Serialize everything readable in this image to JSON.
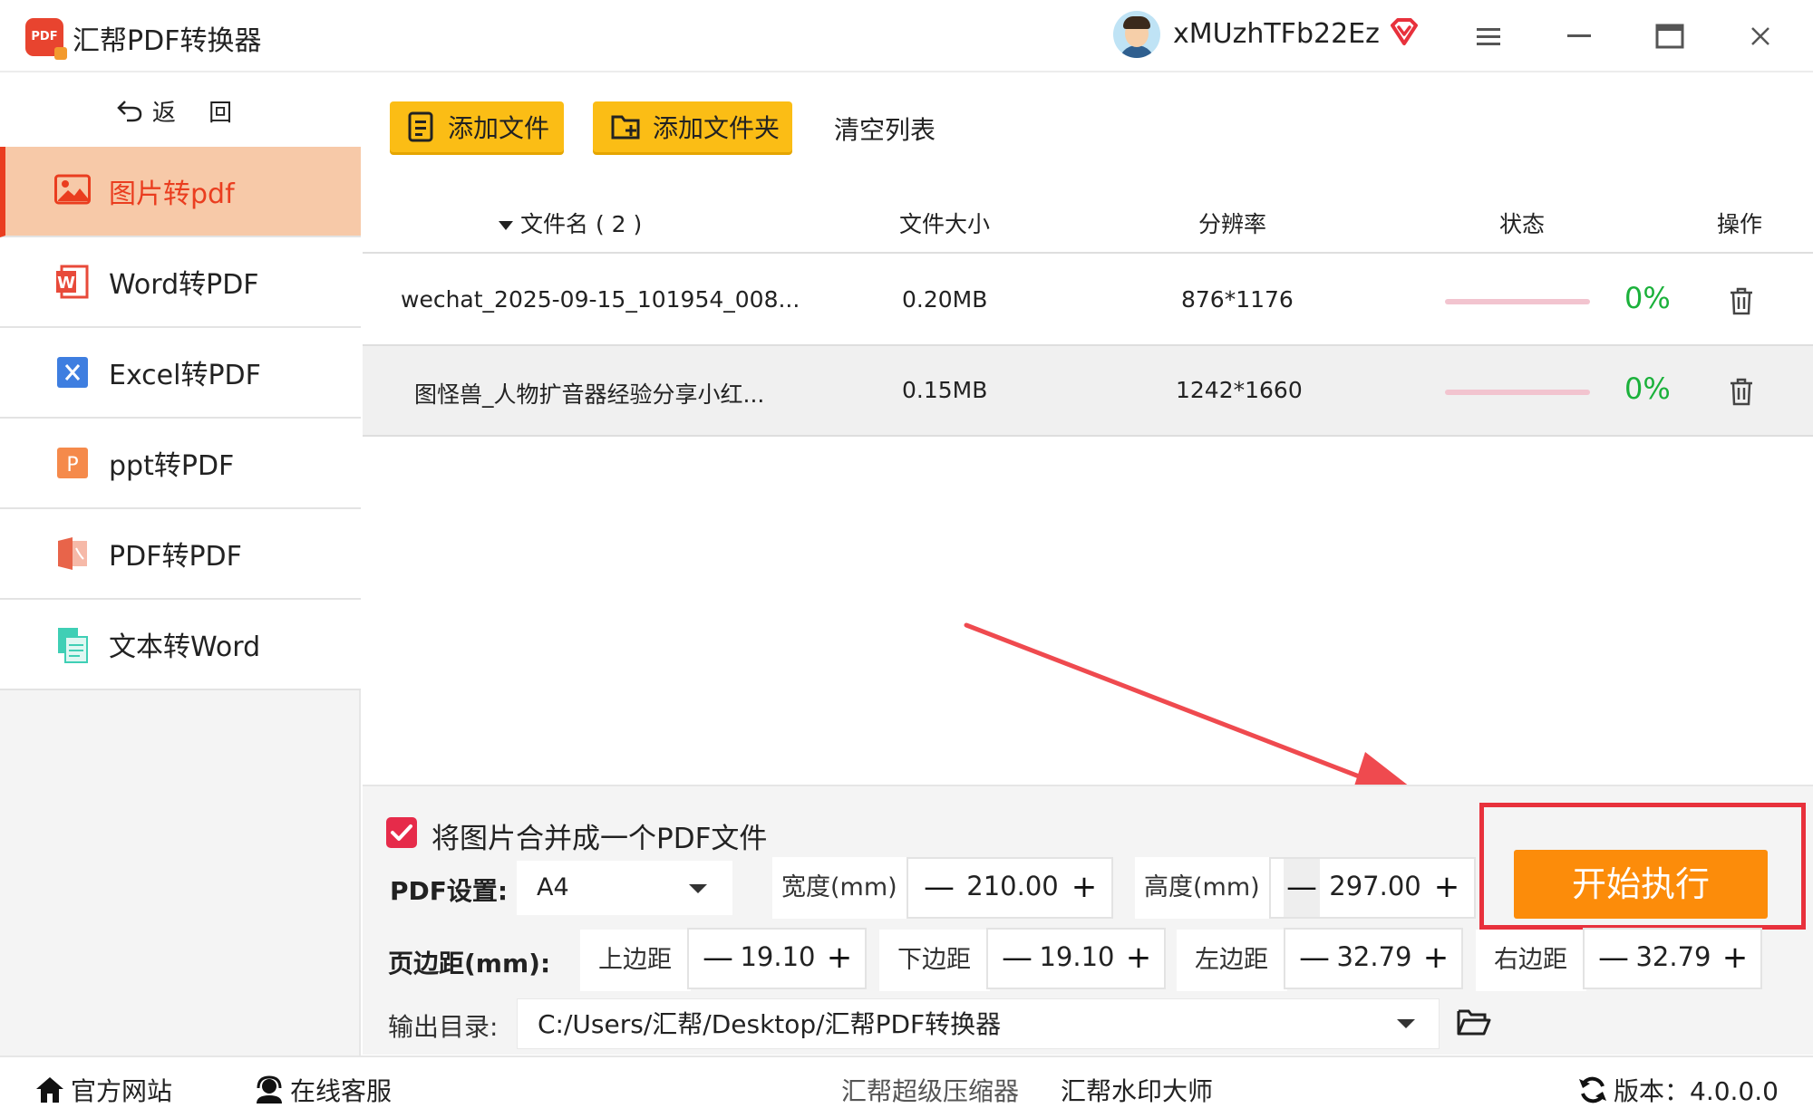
{
  "app": {
    "title": "汇帮PDF转换器",
    "logo_text": "PDF",
    "username": "xMUzhTFb22Ez"
  },
  "sidebar": {
    "back_label": "返 回",
    "items": [
      {
        "label": "图片转pdf",
        "icon": "image-icon",
        "active": true
      },
      {
        "label": "Word转PDF",
        "icon": "word-icon",
        "active": false
      },
      {
        "label": "Excel转PDF",
        "icon": "excel-icon",
        "active": false
      },
      {
        "label": "ppt转PDF",
        "icon": "ppt-icon",
        "active": false
      },
      {
        "label": "PDF转PDF",
        "icon": "pdf-icon",
        "active": false
      },
      {
        "label": "文本转Word",
        "icon": "text-doc-icon",
        "active": false
      }
    ]
  },
  "toolbar": {
    "add_file": "添加文件",
    "add_folder": "添加文件夹",
    "clear_list": "清空列表"
  },
  "table": {
    "headers": {
      "name": "文件名 ( 2 )",
      "size": "文件大小",
      "resolution": "分辨率",
      "status": "状态",
      "action": "操作"
    },
    "rows": [
      {
        "name": "wechat_2025-09-15_101954_008...",
        "size": "0.20MB",
        "resolution": "876*1176",
        "progress": "0%"
      },
      {
        "name": "图怪兽_人物扩音器经验分享小红...",
        "size": "0.15MB",
        "resolution": "1242*1660",
        "progress": "0%"
      }
    ]
  },
  "settings": {
    "merge_label": "将图片合并成一个PDF文件",
    "merge_checked": true,
    "pdf_settings_label": "PDF设置:",
    "page_size": "A4",
    "width_label": "宽度(mm)",
    "width_value": "210.00",
    "height_label": "高度(mm)",
    "height_value": "297.00",
    "margin_label": "页边距(mm):",
    "top_label": "上边距",
    "top_value": "19.10",
    "bottom_label": "下边距",
    "bottom_value": "19.10",
    "left_label": "左边距",
    "left_value": "32.79",
    "right_label": "右边距",
    "right_value": "32.79",
    "output_label": "输出目录:",
    "output_path": "C:/Users/汇帮/Desktop/汇帮PDF转换器",
    "start_button": "开始执行",
    "minus": "—",
    "plus": "+"
  },
  "statusbar": {
    "website": "官方网站",
    "support": "在线客服",
    "compressor": "汇帮超级压缩器",
    "watermark": "汇帮水印大师",
    "version": "版本：4.0.0.0"
  },
  "colors": {
    "accent": "#fbbd15",
    "active_menu_bg": "#f7c9a8",
    "active_menu_text": "#ea3d1f",
    "progress_text": "#1bb13b",
    "start_button": "#fc8c0a",
    "highlight": "#e8313c"
  }
}
